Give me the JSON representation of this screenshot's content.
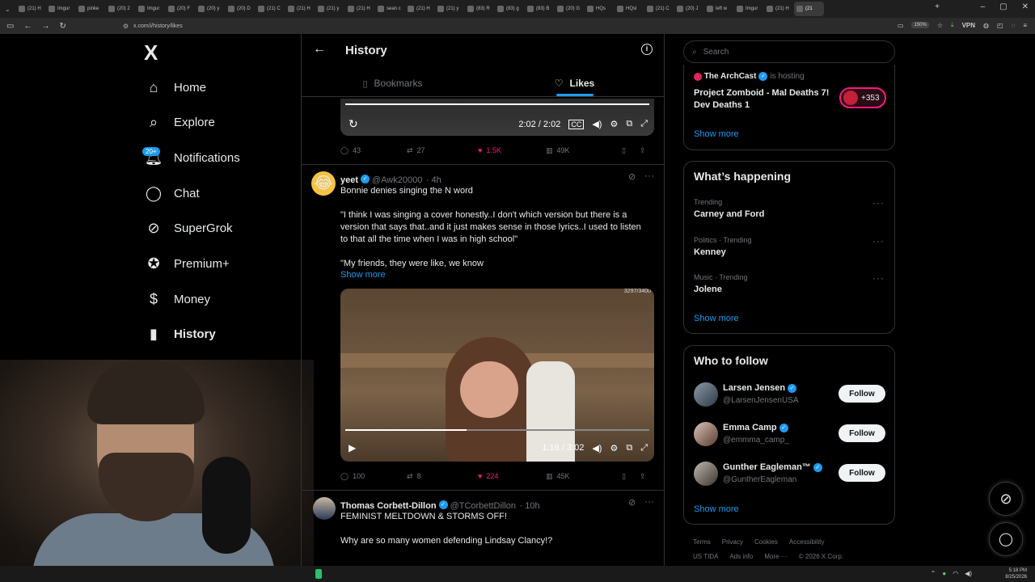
{
  "browser": {
    "tabs": [
      "(21) H",
      "Imgur",
      "pinke",
      "(20) 2",
      "Imgur",
      "(20) F",
      "(20) y",
      "(20) D",
      "(21) C",
      "(21) H",
      "(21) y",
      "(21) H",
      "sean c",
      "(21) H",
      "(21) y",
      "(83) R",
      "(83) g",
      "(83) B",
      "(20) G",
      "HQs",
      "HQsl",
      "(21) C",
      "(20) J",
      "left w",
      "Imgur",
      "(21) H",
      "(21"
    ],
    "url": "x.com/i/history/likes",
    "zoom": "150%",
    "vpn": "VPN"
  },
  "sidebar": {
    "logo": "X",
    "items": [
      {
        "label": "Home",
        "icon": "home-icon"
      },
      {
        "label": "Explore",
        "icon": "search-icon"
      },
      {
        "label": "Notifications",
        "icon": "bell-icon"
      },
      {
        "label": "Chat",
        "icon": "chat-icon"
      },
      {
        "label": "SuperGrok",
        "icon": "grok-icon"
      },
      {
        "label": "Premium+",
        "icon": "verified-icon"
      },
      {
        "label": "Money",
        "icon": "dollar-icon"
      },
      {
        "label": "History",
        "icon": "bookmark-icon"
      }
    ],
    "notif_badge": "20+"
  },
  "header": {
    "title": "History"
  },
  "tabs": {
    "bookmarks": "Bookmarks",
    "likes": "Likes"
  },
  "posts": [
    {
      "video_time": "2:02 / 2:02",
      "replies": "43",
      "reposts": "27",
      "likes": "1.5K",
      "views": "49K"
    },
    {
      "name": "yeet",
      "handle": "@Awk20000",
      "time": "· 4h",
      "line1": "Bonnie denies singing the N word",
      "line2": "\"I think I was singing a cover honestly..I don't which version but there is a version that says that..and it just makes sense in those lyrics..I used to listen to that all the time when I was in high school\"",
      "line3": "\"My friends, they were like, we know",
      "show_more": "Show more",
      "video_counter": "3297/3400",
      "video_time": "1:16 / 3:02",
      "replies": "100",
      "reposts": "8",
      "likes": "224",
      "views": "45K"
    },
    {
      "name": "Thomas Corbett-Dillon",
      "handle": "@TCorbettDillon",
      "time": "· 10h",
      "line1": "FEMINIST MELTDOWN & STORMS OFF!",
      "line2": "Why are so many women defending Lindsay Clancy!?"
    }
  ],
  "right": {
    "search_placeholder": "Search",
    "live": {
      "host": "The ArchCast",
      "hosting": "is hosting",
      "title": "Project Zomboid - Mal Deaths 7! Dev Deaths 1",
      "count": "+353",
      "show_more": "Show more"
    },
    "happening": {
      "title": "What’s happening",
      "trends": [
        {
          "category": "Trending",
          "name": "Carney and Ford"
        },
        {
          "category": "Politics · Trending",
          "name": "Kenney"
        },
        {
          "category": "Music · Trending",
          "name": "Jolene"
        }
      ],
      "show_more": "Show more"
    },
    "who_to_follow": {
      "title": "Who to follow",
      "users": [
        {
          "name": "Larsen Jensen",
          "handle": "@LarsenJensenUSA",
          "button": "Follow"
        },
        {
          "name": "Emma Camp",
          "handle": "@emmma_camp_",
          "button": "Follow"
        },
        {
          "name": "Gunther Eagleman™",
          "handle": "@GuntherEagleman",
          "button": "Follow"
        }
      ],
      "show_more": "Show more"
    },
    "footer": {
      "row1": [
        "Terms",
        "Privacy",
        "Cookies",
        "Accessibility"
      ],
      "row2": [
        "US TIDA",
        "Ads info",
        "More ···",
        "© 2026 X Corp."
      ]
    }
  },
  "taskbar": {
    "time": "5:18 PM",
    "date": "8/25/2026"
  },
  "colors": {
    "accent": "#1d9bf0",
    "like": "#f91880",
    "bg": "#000000",
    "border": "#2f3336"
  }
}
